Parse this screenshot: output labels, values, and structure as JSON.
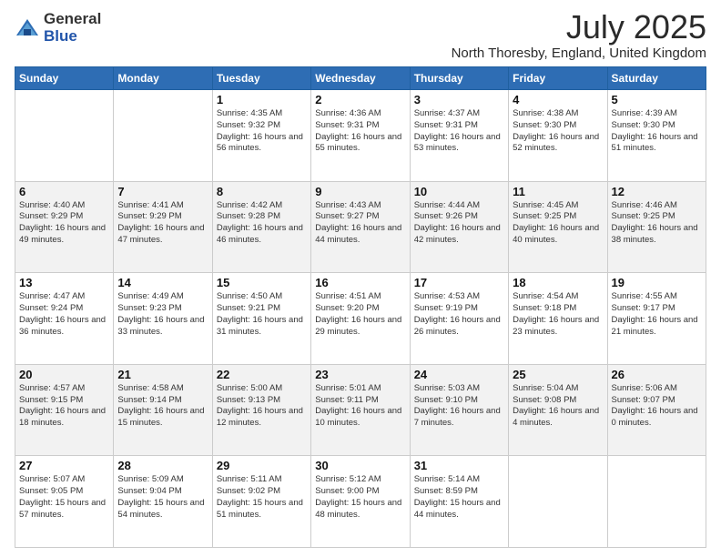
{
  "logo": {
    "general": "General",
    "blue": "Blue"
  },
  "title": "July 2025",
  "location": "North Thoresby, England, United Kingdom",
  "days_of_week": [
    "Sunday",
    "Monday",
    "Tuesday",
    "Wednesday",
    "Thursday",
    "Friday",
    "Saturday"
  ],
  "weeks": [
    [
      {
        "day": "",
        "info": ""
      },
      {
        "day": "",
        "info": ""
      },
      {
        "day": "1",
        "info": "Sunrise: 4:35 AM\nSunset: 9:32 PM\nDaylight: 16 hours and 56 minutes."
      },
      {
        "day": "2",
        "info": "Sunrise: 4:36 AM\nSunset: 9:31 PM\nDaylight: 16 hours and 55 minutes."
      },
      {
        "day": "3",
        "info": "Sunrise: 4:37 AM\nSunset: 9:31 PM\nDaylight: 16 hours and 53 minutes."
      },
      {
        "day": "4",
        "info": "Sunrise: 4:38 AM\nSunset: 9:30 PM\nDaylight: 16 hours and 52 minutes."
      },
      {
        "day": "5",
        "info": "Sunrise: 4:39 AM\nSunset: 9:30 PM\nDaylight: 16 hours and 51 minutes."
      }
    ],
    [
      {
        "day": "6",
        "info": "Sunrise: 4:40 AM\nSunset: 9:29 PM\nDaylight: 16 hours and 49 minutes."
      },
      {
        "day": "7",
        "info": "Sunrise: 4:41 AM\nSunset: 9:29 PM\nDaylight: 16 hours and 47 minutes."
      },
      {
        "day": "8",
        "info": "Sunrise: 4:42 AM\nSunset: 9:28 PM\nDaylight: 16 hours and 46 minutes."
      },
      {
        "day": "9",
        "info": "Sunrise: 4:43 AM\nSunset: 9:27 PM\nDaylight: 16 hours and 44 minutes."
      },
      {
        "day": "10",
        "info": "Sunrise: 4:44 AM\nSunset: 9:26 PM\nDaylight: 16 hours and 42 minutes."
      },
      {
        "day": "11",
        "info": "Sunrise: 4:45 AM\nSunset: 9:25 PM\nDaylight: 16 hours and 40 minutes."
      },
      {
        "day": "12",
        "info": "Sunrise: 4:46 AM\nSunset: 9:25 PM\nDaylight: 16 hours and 38 minutes."
      }
    ],
    [
      {
        "day": "13",
        "info": "Sunrise: 4:47 AM\nSunset: 9:24 PM\nDaylight: 16 hours and 36 minutes."
      },
      {
        "day": "14",
        "info": "Sunrise: 4:49 AM\nSunset: 9:23 PM\nDaylight: 16 hours and 33 minutes."
      },
      {
        "day": "15",
        "info": "Sunrise: 4:50 AM\nSunset: 9:21 PM\nDaylight: 16 hours and 31 minutes."
      },
      {
        "day": "16",
        "info": "Sunrise: 4:51 AM\nSunset: 9:20 PM\nDaylight: 16 hours and 29 minutes."
      },
      {
        "day": "17",
        "info": "Sunrise: 4:53 AM\nSunset: 9:19 PM\nDaylight: 16 hours and 26 minutes."
      },
      {
        "day": "18",
        "info": "Sunrise: 4:54 AM\nSunset: 9:18 PM\nDaylight: 16 hours and 23 minutes."
      },
      {
        "day": "19",
        "info": "Sunrise: 4:55 AM\nSunset: 9:17 PM\nDaylight: 16 hours and 21 minutes."
      }
    ],
    [
      {
        "day": "20",
        "info": "Sunrise: 4:57 AM\nSunset: 9:15 PM\nDaylight: 16 hours and 18 minutes."
      },
      {
        "day": "21",
        "info": "Sunrise: 4:58 AM\nSunset: 9:14 PM\nDaylight: 16 hours and 15 minutes."
      },
      {
        "day": "22",
        "info": "Sunrise: 5:00 AM\nSunset: 9:13 PM\nDaylight: 16 hours and 12 minutes."
      },
      {
        "day": "23",
        "info": "Sunrise: 5:01 AM\nSunset: 9:11 PM\nDaylight: 16 hours and 10 minutes."
      },
      {
        "day": "24",
        "info": "Sunrise: 5:03 AM\nSunset: 9:10 PM\nDaylight: 16 hours and 7 minutes."
      },
      {
        "day": "25",
        "info": "Sunrise: 5:04 AM\nSunset: 9:08 PM\nDaylight: 16 hours and 4 minutes."
      },
      {
        "day": "26",
        "info": "Sunrise: 5:06 AM\nSunset: 9:07 PM\nDaylight: 16 hours and 0 minutes."
      }
    ],
    [
      {
        "day": "27",
        "info": "Sunrise: 5:07 AM\nSunset: 9:05 PM\nDaylight: 15 hours and 57 minutes."
      },
      {
        "day": "28",
        "info": "Sunrise: 5:09 AM\nSunset: 9:04 PM\nDaylight: 15 hours and 54 minutes."
      },
      {
        "day": "29",
        "info": "Sunrise: 5:11 AM\nSunset: 9:02 PM\nDaylight: 15 hours and 51 minutes."
      },
      {
        "day": "30",
        "info": "Sunrise: 5:12 AM\nSunset: 9:00 PM\nDaylight: 15 hours and 48 minutes."
      },
      {
        "day": "31",
        "info": "Sunrise: 5:14 AM\nSunset: 8:59 PM\nDaylight: 15 hours and 44 minutes."
      },
      {
        "day": "",
        "info": ""
      },
      {
        "day": "",
        "info": ""
      }
    ]
  ]
}
